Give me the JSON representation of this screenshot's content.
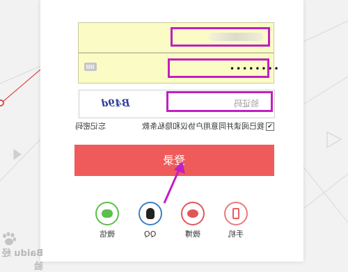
{
  "form": {
    "username_value": "",
    "password_value": "••••••••",
    "captcha_code": "B49d",
    "captcha_placeholder": "验证码",
    "agree_text": "我已阅读并同意用户协议和隐私条款",
    "checkbox_mark": "✔",
    "forgot_link": "忘记密码",
    "login_button": "登录"
  },
  "social": {
    "wechat": "微信",
    "qq": "QQ",
    "weibo": "微博",
    "phone": "手机"
  },
  "watermark": "Baidu 经验",
  "colors": {
    "login_button": "#ef5b5b",
    "highlight": "#c21ec2",
    "field_fill": "#fbfbc6",
    "wechat": "#5cbf4a",
    "qq": "#3a80c6",
    "weibo": "#e0575b"
  }
}
